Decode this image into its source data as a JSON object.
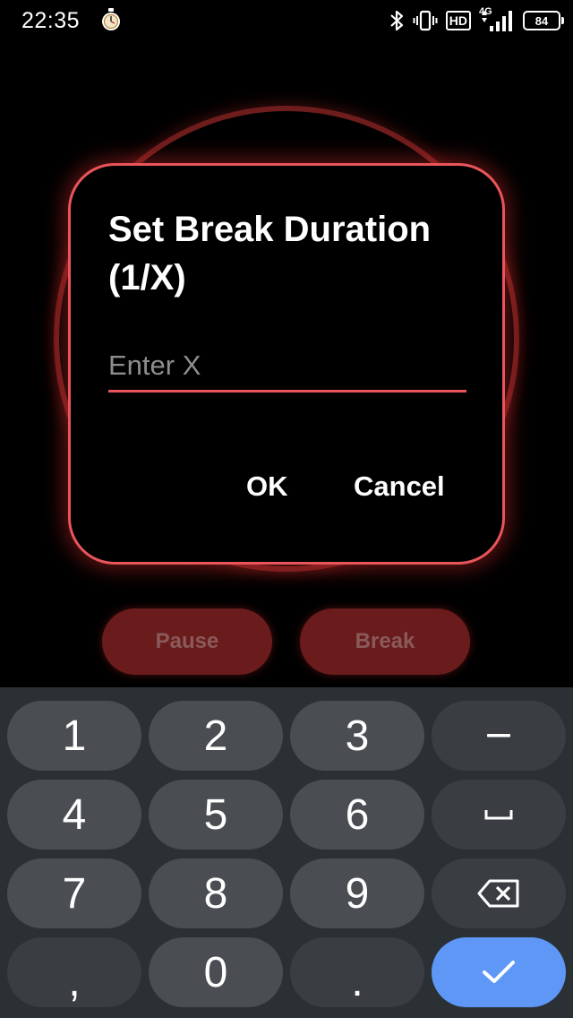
{
  "status_bar": {
    "time": "22:35",
    "hd_label": "HD",
    "network_label": "4G",
    "battery_level": "84"
  },
  "background": {
    "pause_label": "Pause",
    "break_label": "Break"
  },
  "dialog": {
    "title": "Set Break Duration (1/X)",
    "input_placeholder": "Enter X",
    "input_value": "",
    "ok_label": "OK",
    "cancel_label": "Cancel"
  },
  "keyboard": {
    "keys": [
      "1",
      "2",
      "3",
      "4",
      "5",
      "6",
      "7",
      "8",
      "9",
      ",",
      "0",
      "."
    ],
    "function_keys": [
      "minus-icon",
      "space-icon",
      "backspace-icon",
      "checkmark-icon"
    ]
  },
  "colors": {
    "accent": "#e8555b",
    "keyboard_bg": "#2b3035",
    "key_bg": "#4a4e53",
    "enter_key": "#5e97f6"
  }
}
